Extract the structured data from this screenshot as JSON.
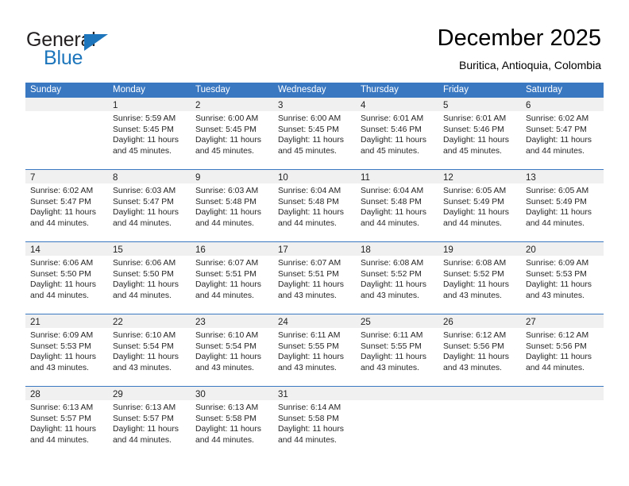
{
  "logo": {
    "word_top": "General",
    "word_bottom": "Blue",
    "accent_color": "#1d76bb",
    "triangle_icon": "triangle-icon"
  },
  "header": {
    "title": "December 2025",
    "subtitle": "Buritica, Antioquia, Colombia"
  },
  "calendar": {
    "header_color": "#3b78c2",
    "daynum_band_color": "#f0f0f0",
    "weekday_headers": [
      "Sunday",
      "Monday",
      "Tuesday",
      "Wednesday",
      "Thursday",
      "Friday",
      "Saturday"
    ],
    "weeks": [
      [
        {
          "day": "",
          "sunrise": "",
          "sunset": "",
          "daylight": ""
        },
        {
          "day": "1",
          "sunrise": "Sunrise: 5:59 AM",
          "sunset": "Sunset: 5:45 PM",
          "daylight": "Daylight: 11 hours and 45 minutes."
        },
        {
          "day": "2",
          "sunrise": "Sunrise: 6:00 AM",
          "sunset": "Sunset: 5:45 PM",
          "daylight": "Daylight: 11 hours and 45 minutes."
        },
        {
          "day": "3",
          "sunrise": "Sunrise: 6:00 AM",
          "sunset": "Sunset: 5:45 PM",
          "daylight": "Daylight: 11 hours and 45 minutes."
        },
        {
          "day": "4",
          "sunrise": "Sunrise: 6:01 AM",
          "sunset": "Sunset: 5:46 PM",
          "daylight": "Daylight: 11 hours and 45 minutes."
        },
        {
          "day": "5",
          "sunrise": "Sunrise: 6:01 AM",
          "sunset": "Sunset: 5:46 PM",
          "daylight": "Daylight: 11 hours and 45 minutes."
        },
        {
          "day": "6",
          "sunrise": "Sunrise: 6:02 AM",
          "sunset": "Sunset: 5:47 PM",
          "daylight": "Daylight: 11 hours and 44 minutes."
        }
      ],
      [
        {
          "day": "7",
          "sunrise": "Sunrise: 6:02 AM",
          "sunset": "Sunset: 5:47 PM",
          "daylight": "Daylight: 11 hours and 44 minutes."
        },
        {
          "day": "8",
          "sunrise": "Sunrise: 6:03 AM",
          "sunset": "Sunset: 5:47 PM",
          "daylight": "Daylight: 11 hours and 44 minutes."
        },
        {
          "day": "9",
          "sunrise": "Sunrise: 6:03 AM",
          "sunset": "Sunset: 5:48 PM",
          "daylight": "Daylight: 11 hours and 44 minutes."
        },
        {
          "day": "10",
          "sunrise": "Sunrise: 6:04 AM",
          "sunset": "Sunset: 5:48 PM",
          "daylight": "Daylight: 11 hours and 44 minutes."
        },
        {
          "day": "11",
          "sunrise": "Sunrise: 6:04 AM",
          "sunset": "Sunset: 5:48 PM",
          "daylight": "Daylight: 11 hours and 44 minutes."
        },
        {
          "day": "12",
          "sunrise": "Sunrise: 6:05 AM",
          "sunset": "Sunset: 5:49 PM",
          "daylight": "Daylight: 11 hours and 44 minutes."
        },
        {
          "day": "13",
          "sunrise": "Sunrise: 6:05 AM",
          "sunset": "Sunset: 5:49 PM",
          "daylight": "Daylight: 11 hours and 44 minutes."
        }
      ],
      [
        {
          "day": "14",
          "sunrise": "Sunrise: 6:06 AM",
          "sunset": "Sunset: 5:50 PM",
          "daylight": "Daylight: 11 hours and 44 minutes."
        },
        {
          "day": "15",
          "sunrise": "Sunrise: 6:06 AM",
          "sunset": "Sunset: 5:50 PM",
          "daylight": "Daylight: 11 hours and 44 minutes."
        },
        {
          "day": "16",
          "sunrise": "Sunrise: 6:07 AM",
          "sunset": "Sunset: 5:51 PM",
          "daylight": "Daylight: 11 hours and 44 minutes."
        },
        {
          "day": "17",
          "sunrise": "Sunrise: 6:07 AM",
          "sunset": "Sunset: 5:51 PM",
          "daylight": "Daylight: 11 hours and 43 minutes."
        },
        {
          "day": "18",
          "sunrise": "Sunrise: 6:08 AM",
          "sunset": "Sunset: 5:52 PM",
          "daylight": "Daylight: 11 hours and 43 minutes."
        },
        {
          "day": "19",
          "sunrise": "Sunrise: 6:08 AM",
          "sunset": "Sunset: 5:52 PM",
          "daylight": "Daylight: 11 hours and 43 minutes."
        },
        {
          "day": "20",
          "sunrise": "Sunrise: 6:09 AM",
          "sunset": "Sunset: 5:53 PM",
          "daylight": "Daylight: 11 hours and 43 minutes."
        }
      ],
      [
        {
          "day": "21",
          "sunrise": "Sunrise: 6:09 AM",
          "sunset": "Sunset: 5:53 PM",
          "daylight": "Daylight: 11 hours and 43 minutes."
        },
        {
          "day": "22",
          "sunrise": "Sunrise: 6:10 AM",
          "sunset": "Sunset: 5:54 PM",
          "daylight": "Daylight: 11 hours and 43 minutes."
        },
        {
          "day": "23",
          "sunrise": "Sunrise: 6:10 AM",
          "sunset": "Sunset: 5:54 PM",
          "daylight": "Daylight: 11 hours and 43 minutes."
        },
        {
          "day": "24",
          "sunrise": "Sunrise: 6:11 AM",
          "sunset": "Sunset: 5:55 PM",
          "daylight": "Daylight: 11 hours and 43 minutes."
        },
        {
          "day": "25",
          "sunrise": "Sunrise: 6:11 AM",
          "sunset": "Sunset: 5:55 PM",
          "daylight": "Daylight: 11 hours and 43 minutes."
        },
        {
          "day": "26",
          "sunrise": "Sunrise: 6:12 AM",
          "sunset": "Sunset: 5:56 PM",
          "daylight": "Daylight: 11 hours and 43 minutes."
        },
        {
          "day": "27",
          "sunrise": "Sunrise: 6:12 AM",
          "sunset": "Sunset: 5:56 PM",
          "daylight": "Daylight: 11 hours and 44 minutes."
        }
      ],
      [
        {
          "day": "28",
          "sunrise": "Sunrise: 6:13 AM",
          "sunset": "Sunset: 5:57 PM",
          "daylight": "Daylight: 11 hours and 44 minutes."
        },
        {
          "day": "29",
          "sunrise": "Sunrise: 6:13 AM",
          "sunset": "Sunset: 5:57 PM",
          "daylight": "Daylight: 11 hours and 44 minutes."
        },
        {
          "day": "30",
          "sunrise": "Sunrise: 6:13 AM",
          "sunset": "Sunset: 5:58 PM",
          "daylight": "Daylight: 11 hours and 44 minutes."
        },
        {
          "day": "31",
          "sunrise": "Sunrise: 6:14 AM",
          "sunset": "Sunset: 5:58 PM",
          "daylight": "Daylight: 11 hours and 44 minutes."
        },
        {
          "day": "",
          "sunrise": "",
          "sunset": "",
          "daylight": ""
        },
        {
          "day": "",
          "sunrise": "",
          "sunset": "",
          "daylight": ""
        },
        {
          "day": "",
          "sunrise": "",
          "sunset": "",
          "daylight": ""
        }
      ]
    ]
  }
}
